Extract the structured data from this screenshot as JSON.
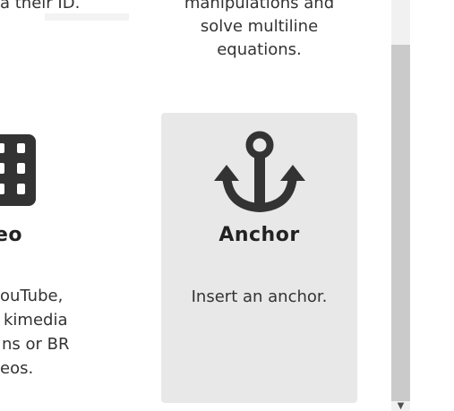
{
  "left_card": {
    "top_partial": "a their ID.",
    "title": "eo",
    "desc_lines": [
      "ouTube,",
      "kimedia",
      "ns or BR",
      "eos."
    ],
    "icon": "film-icon"
  },
  "top_center": {
    "lines": [
      "manipulations and",
      "solve multiline",
      "equations."
    ]
  },
  "anchor_card": {
    "title": "Anchor",
    "description": "Insert an anchor.",
    "icon": "anchor-icon"
  },
  "colors": {
    "card_bg": "#e8e8e8",
    "icon": "#333333",
    "scroll_thumb": "#cacaca"
  }
}
